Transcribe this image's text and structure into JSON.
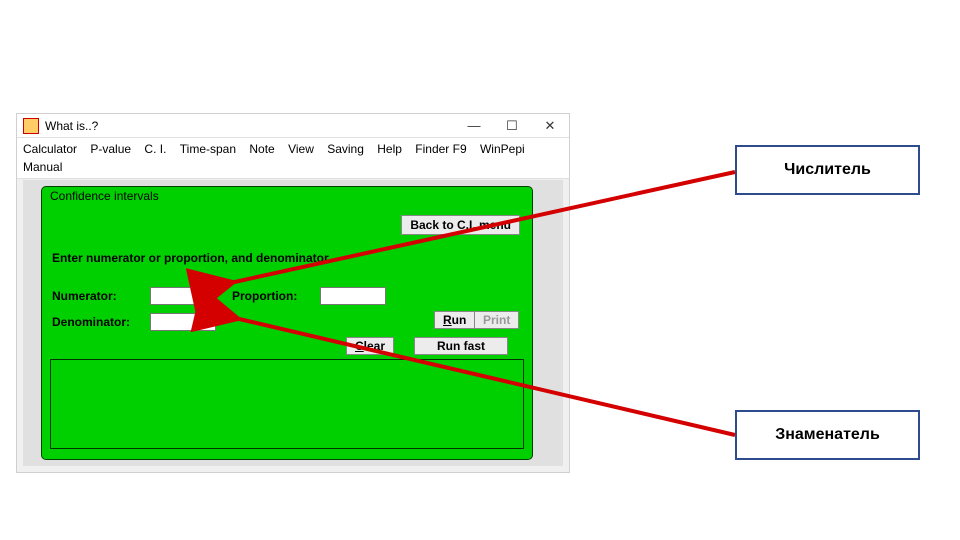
{
  "window": {
    "title": "What is..?"
  },
  "menu": {
    "items": [
      "Calculator",
      "P-value",
      "C. I.",
      "Time-span",
      "Note",
      "View",
      "Saving",
      "Help",
      "Finder F9",
      "WinPepi",
      "Manual"
    ]
  },
  "panel": {
    "title": "Confidence intervals",
    "back": "Back to C.I. menu",
    "instruction": "Enter numerator or proportion, and denominator",
    "numerator_label": "Numerator:",
    "proportion_label": "Proportion:",
    "denominator_label": "Denominator:",
    "numerator_value": "",
    "proportion_value": "",
    "denominator_value": "",
    "run": "un",
    "run_prefix": "R",
    "print": "Print",
    "clear": "lear",
    "clear_prefix": "C",
    "runfast": "Run fast"
  },
  "callouts": {
    "numerator": "Числитель",
    "denominator": "Знаменатель"
  }
}
